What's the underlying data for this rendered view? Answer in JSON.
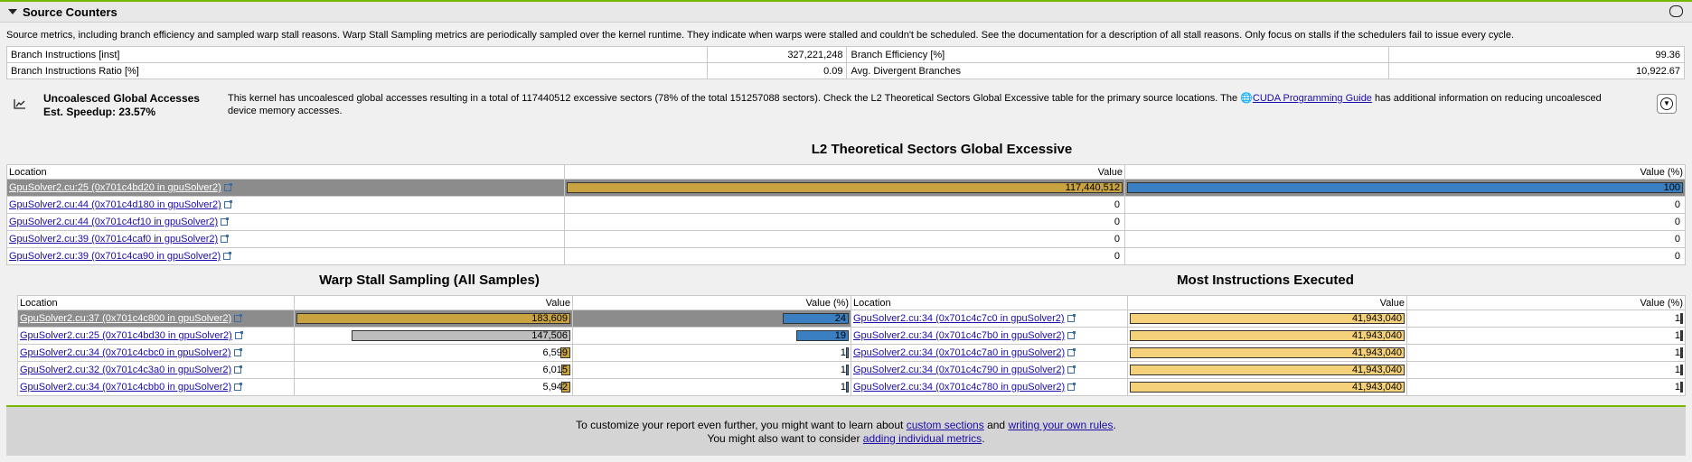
{
  "section": {
    "title": "Source Counters"
  },
  "description": "Source metrics, including branch efficiency and sampled warp stall reasons. Warp Stall Sampling metrics are periodically sampled over the kernel runtime. They indicate when warps were stalled and couldn't be scheduled. See the documentation for a description of all stall reasons. Only focus on stalls if the schedulers fail to issue every cycle.",
  "metrics": [
    {
      "l_name": "Branch Instructions [inst]",
      "l_value": "327,221,248",
      "r_name": "Branch Efficiency [%]",
      "r_value": "99.36"
    },
    {
      "l_name": "Branch Instructions Ratio [%]",
      "l_value": "0.09",
      "r_name": "Avg. Divergent Branches",
      "r_value": "10,922.67"
    }
  ],
  "suggestion": {
    "name": "Uncoalesced Global Accesses",
    "speedup": "Est. Speedup: 23.57%",
    "msg_before": "This kernel has uncoalesced global accesses resulting in a total of 117440512 excessive sectors (78% of the total 151257088 sectors). Check the L2 Theoretical Sectors Global Excessive table for the primary source locations. The ",
    "link": "CUDA Programming Guide",
    "msg_after": " has additional information on reducing uncoalesced device memory accesses."
  },
  "l2_table": {
    "title": "L2 Theoretical Sectors Global Excessive",
    "headers": {
      "location": "Location",
      "value": "Value",
      "pct": "Value (%)"
    },
    "rows": [
      {
        "loc": "GpuSolver2.cu:25 (0x701c4bd20 in gpuSolver2)",
        "value": "117,440,512",
        "pct": "100",
        "value_frac": 1.0,
        "pct_frac": 1.0
      },
      {
        "loc": "GpuSolver2.cu:44 (0x701c4d180 in gpuSolver2)",
        "value": "0",
        "pct": "0",
        "value_frac": 0,
        "pct_frac": 0
      },
      {
        "loc": "GpuSolver2.cu:44 (0x701c4cf10 in gpuSolver2)",
        "value": "0",
        "pct": "0",
        "value_frac": 0,
        "pct_frac": 0
      },
      {
        "loc": "GpuSolver2.cu:39 (0x701c4caf0 in gpuSolver2)",
        "value": "0",
        "pct": "0",
        "value_frac": 0,
        "pct_frac": 0
      },
      {
        "loc": "GpuSolver2.cu:39 (0x701c4ca90 in gpuSolver2)",
        "value": "0",
        "pct": "0",
        "value_frac": 0,
        "pct_frac": 0
      }
    ]
  },
  "warp_table": {
    "title": "Warp Stall Sampling (All Samples)",
    "headers": {
      "location": "Location",
      "value": "Value",
      "pct": "Value (%)"
    },
    "rows": [
      {
        "loc": "GpuSolver2.cu:37 (0x701c4c800 in gpuSolver2)",
        "value": "183,609",
        "pct": "24",
        "value_frac": 1.0,
        "pct_frac": 0.24
      },
      {
        "loc": "GpuSolver2.cu:25 (0x701c4bd30 in gpuSolver2)",
        "value": "147,506",
        "pct": "19",
        "value_frac": 0.8,
        "pct_frac": 0.19
      },
      {
        "loc": "GpuSolver2.cu:34 (0x701c4cbc0 in gpuSolver2)",
        "value": "6,599",
        "pct": "1",
        "value_frac": 0.036,
        "pct_frac": 0.01
      },
      {
        "loc": "GpuSolver2.cu:32 (0x701c4c3a0 in gpuSolver2)",
        "value": "6,015",
        "pct": "1",
        "value_frac": 0.033,
        "pct_frac": 0.01
      },
      {
        "loc": "GpuSolver2.cu:34 (0x701c4cbb0 in gpuSolver2)",
        "value": "5,942",
        "pct": "1",
        "value_frac": 0.032,
        "pct_frac": 0.01
      }
    ]
  },
  "instr_table": {
    "title": "Most Instructions Executed",
    "headers": {
      "location": "Location",
      "value": "Value",
      "pct": "Value (%)"
    },
    "rows": [
      {
        "loc": "GpuSolver2.cu:34 (0x701c4c7c0 in gpuSolver2)",
        "value": "41,943,040",
        "pct": "1",
        "value_frac": 1.0,
        "pct_frac": 0.01
      },
      {
        "loc": "GpuSolver2.cu:34 (0x701c4c7b0 in gpuSolver2)",
        "value": "41,943,040",
        "pct": "1",
        "value_frac": 1.0,
        "pct_frac": 0.01
      },
      {
        "loc": "GpuSolver2.cu:34 (0x701c4c7a0 in gpuSolver2)",
        "value": "41,943,040",
        "pct": "1",
        "value_frac": 1.0,
        "pct_frac": 0.01
      },
      {
        "loc": "GpuSolver2.cu:34 (0x701c4c790 in gpuSolver2)",
        "value": "41,943,040",
        "pct": "1",
        "value_frac": 1.0,
        "pct_frac": 0.01
      },
      {
        "loc": "GpuSolver2.cu:34 (0x701c4c780 in gpuSolver2)",
        "value": "41,943,040",
        "pct": "1",
        "value_frac": 1.0,
        "pct_frac": 0.01
      }
    ]
  },
  "footer": {
    "line1_a": "To customize your report even further, you might want to learn about ",
    "link1": "custom sections",
    "line1_b": " and ",
    "link2": "writing your own rules",
    "line1_c": ".",
    "line2_a": "You might also want to consider ",
    "link3": "adding individual metrics",
    "line2_b": "."
  },
  "colors": {
    "accent": "#76b900",
    "gold_bar": "#c9a340",
    "blue_bar": "#3a7fc1",
    "light_gold_bar": "#f5d27a",
    "gray_bar": "#bdbdbd",
    "selected_row": "#8c8c8c"
  }
}
